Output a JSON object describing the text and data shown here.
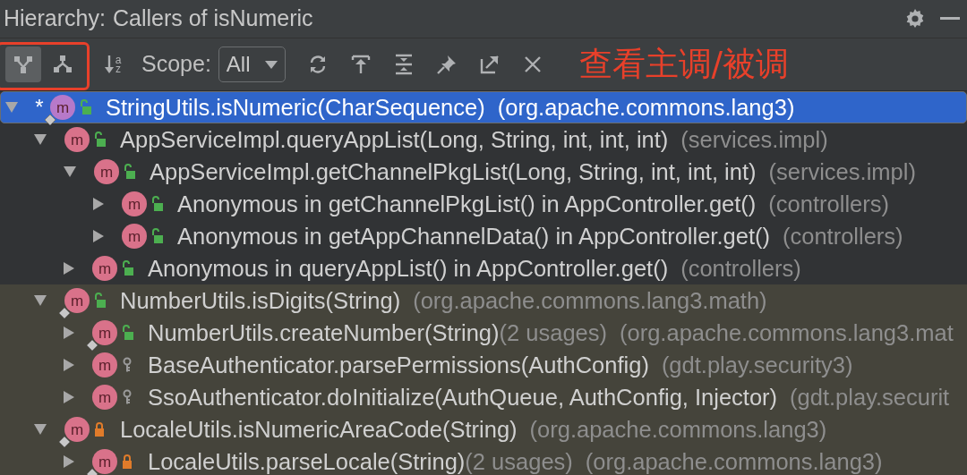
{
  "window": {
    "title_label": "Hierarchy:",
    "title": "Callers of isNumeric",
    "actions": [
      {
        "kind": "settings"
      },
      {
        "kind": "minimize"
      }
    ]
  },
  "toolbar": {
    "modes": [
      {
        "kind": "callers",
        "selected": true
      },
      {
        "kind": "callees",
        "selected": false
      }
    ],
    "sort_glyph": "az",
    "scope_label": "Scope:",
    "scope_value": "All",
    "actions": [
      {
        "kind": "refresh"
      },
      {
        "kind": "jump"
      },
      {
        "kind": "expand-all"
      },
      {
        "kind": "pin"
      },
      {
        "kind": "open-external"
      },
      {
        "kind": "close"
      }
    ]
  },
  "annotation": {
    "text": "查看主调/被调",
    "color": "#e8402a"
  },
  "tree": [
    {
      "icon": "m",
      "kind": "public",
      "badge": true,
      "mark": "*",
      "name": "StringUtils.isNumeric(CharSequence)",
      "package": "(org.apache.commons.lang3)",
      "expanded": true,
      "selected": true,
      "children": [
        {
          "icon": "m",
          "kind": "public",
          "badge": false,
          "name": "AppServiceImpl.queryAppList(Long, String, int, int, int)",
          "package": "(services.impl)",
          "expanded": true,
          "selected": false,
          "color": "#313335",
          "children": [
            {
              "icon": "m",
              "kind": "public",
              "badge": false,
              "name": "AppServiceImpl.getChannelPkgList(Long, String, int, int, int)",
              "package": "(services.impl)",
              "expanded": true,
              "selected": false,
              "color": "#313335",
              "children": [
                {
                  "icon": "m",
                  "kind": "public",
                  "badge": false,
                  "name": "Anonymous in getChannelPkgList() in AppController.get()",
                  "package": "(controllers)",
                  "expanded": false,
                  "selected": false,
                  "color": "#313335"
                },
                {
                  "icon": "m",
                  "kind": "public",
                  "badge": false,
                  "name": "Anonymous in getAppChannelData() in AppController.get()",
                  "package": "(controllers)",
                  "expanded": false,
                  "selected": false,
                  "color": "#313335"
                }
              ]
            },
            {
              "icon": "m",
              "kind": "public",
              "badge": false,
              "name": "Anonymous in queryAppList() in AppController.get()",
              "package": "(controllers)",
              "expanded": false,
              "selected": false,
              "color": "#313335"
            }
          ]
        },
        {
          "icon": "m",
          "kind": "public",
          "badge": true,
          "name": "NumberUtils.isDigits(String)",
          "package": "(org.apache.commons.lang3.math)",
          "expanded": true,
          "selected": false,
          "color": "#45443b",
          "children": [
            {
              "icon": "m",
              "kind": "public",
              "badge": true,
              "name": "NumberUtils.createNumber(String)",
              "usages": "(2 usages)",
              "package": "(org.apache.commons.lang3.mat",
              "expanded": false,
              "selected": false,
              "color": "#45443b"
            },
            {
              "icon": "m",
              "kind": "package",
              "badge": false,
              "name": "BaseAuthenticator.parsePermissions(AuthConfig)",
              "package": "(gdt.play.security3)",
              "expanded": false,
              "selected": false,
              "color": "#45443b"
            },
            {
              "icon": "m",
              "kind": "package",
              "badge": false,
              "name": "SsoAuthenticator.doInitialize(AuthQueue, AuthConfig, Injector)",
              "package": "(gdt.play.securit",
              "expanded": false,
              "selected": false,
              "color": "#45443b"
            }
          ]
        },
        {
          "icon": "m",
          "kind": "private",
          "badge": true,
          "name": "LocaleUtils.isNumericAreaCode(String)",
          "package": "(org.apache.commons.lang3)",
          "expanded": true,
          "selected": false,
          "color": "#45443b",
          "children": [
            {
              "icon": "m",
              "kind": "private",
              "badge": true,
              "name": "LocaleUtils.parseLocale(String)",
              "usages": "(2 usages)",
              "package": "(org.apache.commons.lang3)",
              "expanded": false,
              "selected": false,
              "color": "#45443b"
            }
          ]
        }
      ]
    }
  ]
}
